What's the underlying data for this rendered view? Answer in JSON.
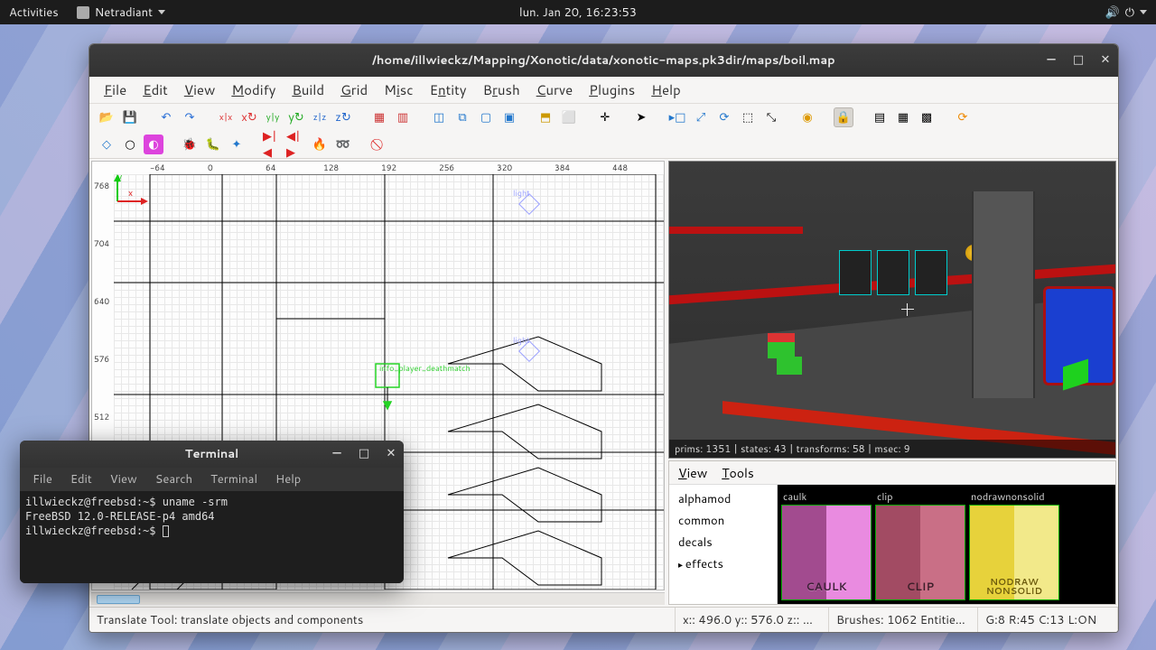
{
  "topbar": {
    "activities": "Activities",
    "app_name": "Netradiant",
    "clock": "lun. Jan 20, 16:23:53"
  },
  "main_window": {
    "title": "/home/illwieckz/Mapping/Xonotic/data/xonotic-maps.pk3dir/maps/boil.map",
    "menus": [
      "File",
      "Edit",
      "View",
      "Modify",
      "Build",
      "Grid",
      "Misc",
      "Entity",
      "Brush",
      "Curve",
      "Plugins",
      "Help"
    ],
    "view3d_status": "prims: 1351 | states: 43 | transforms: 58 | msec: 9",
    "tex_menu": [
      "View",
      "Tools"
    ],
    "tex_categories": [
      "alphamod",
      "common",
      "decals",
      "effects"
    ],
    "textures": [
      {
        "name": "caulk",
        "class": "sw-caulk"
      },
      {
        "name": "clip",
        "class": "sw-clip"
      },
      {
        "name": "nodrawnonsolid",
        "class": "sw-nodraw"
      }
    ],
    "ruler_x": [
      "-64",
      "0",
      "64",
      "128",
      "192",
      "256",
      "320",
      "384",
      "448"
    ],
    "ruler_y": [
      "768",
      "704",
      "640",
      "576",
      "512"
    ],
    "entity_label": "info_player_deathmatch",
    "light_label": "light",
    "axis_x": "x",
    "axis_y": "y",
    "status": {
      "tool": "Translate Tool: translate objects and components",
      "coords": "x:: 496.0 y:: 576.0 z:: …",
      "counts": "Brushes: 1062 Entities: …",
      "grid": "G:8  R:45 C:13  L:ON"
    }
  },
  "terminal": {
    "title": "Terminal",
    "menus": [
      "File",
      "Edit",
      "View",
      "Search",
      "Terminal",
      "Help"
    ],
    "lines": [
      "illwieckz@freebsd:~$ uname -srm",
      "FreeBSD 12.0-RELEASE-p4 amd64",
      "illwieckz@freebsd:~$ "
    ]
  }
}
